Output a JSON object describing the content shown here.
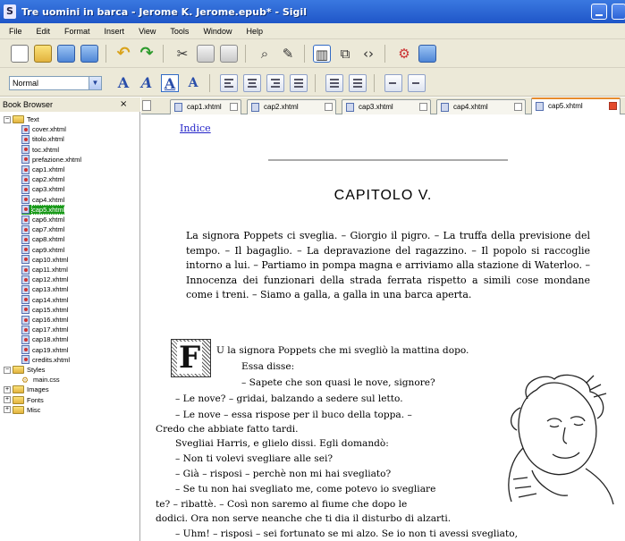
{
  "window": {
    "title": "Tre uomini in barca - Jerome K. Jerome.epub* - Sigil",
    "app_icon_letter": "S"
  },
  "menu": [
    "File",
    "Edit",
    "Format",
    "Insert",
    "View",
    "Tools",
    "Window",
    "Help"
  ],
  "toolbar": {
    "style_select_value": "Normal",
    "heading_buttons": [
      "A",
      "A",
      "A",
      "A"
    ]
  },
  "book_browser": {
    "title": "Book Browser",
    "close_glyph": "×",
    "folders": {
      "text": "Text",
      "styles": "Styles",
      "images": "Images",
      "fonts": "Fonts",
      "misc": "Misc"
    },
    "text_files": [
      "cover.xhtml",
      "titolo.xhtml",
      "toc.xhtml",
      "prefazione.xhtml",
      "cap1.xhtml",
      "cap2.xhtml",
      "cap3.xhtml",
      "cap4.xhtml",
      "cap5.xhtml",
      "cap6.xhtml",
      "cap7.xhtml",
      "cap8.xhtml",
      "cap9.xhtml",
      "cap10.xhtml",
      "cap11.xhtml",
      "cap12.xhtml",
      "cap13.xhtml",
      "cap14.xhtml",
      "cap15.xhtml",
      "cap16.xhtml",
      "cap17.xhtml",
      "cap18.xhtml",
      "cap19.xhtml",
      "credits.xhtml"
    ],
    "selected_file": "cap5.xhtml",
    "style_files": [
      "main.css"
    ]
  },
  "tabs": [
    "cap1.xhtml",
    "cap2.xhtml",
    "cap3.xhtml",
    "cap4.xhtml",
    "cap5.xhtml"
  ],
  "active_tab": "cap5.xhtml",
  "document": {
    "index_link": "Indice",
    "chapter_title": "CAPITOLO V.",
    "summary": "La signora Poppets ci sveglia. – Giorgio il pigro. – La truffa della previsione del tempo. – Il bagaglio. – La depravazione del ragazzino. – Il popolo si raccoglie intorno a lui. – Partiamo in pompa magna e arriviamo alla stazione di Waterloo. – Innocenza dei funzionari della strada ferrata rispetto a simili cose mondane come i treni. – Siamo a galla, a galla in una barca aperta.",
    "dropcap_letter": "F",
    "lines": [
      "U la signora Poppets che mi svegliò la mattina dopo.",
      "Essa disse:",
      "– Sapete che son quasi le nove, signore?",
      "– Le nove? – gridai, balzando a sedere sul letto.",
      "– Le nove – essa rispose per il buco della toppa. –",
      "Credo che abbiate fatto tardi.",
      "Svegliai Harris, e glielo dissi. Egli domandò:",
      "– Non ti volevi svegliare alle sei?",
      "– Già – risposi – perchè non mi hai svegliato?",
      "– Se tu non hai svegliato me, come potevo io svegliare",
      "te? – ribattè. – Così non saremo al fiume che dopo le",
      "dodici. Ora non serve neanche che ti dia il disturbo di alzarti.",
      "– Uhm! – risposi – sei fortunato se mi alzo. Se io non ti avessi svegliato,"
    ]
  }
}
